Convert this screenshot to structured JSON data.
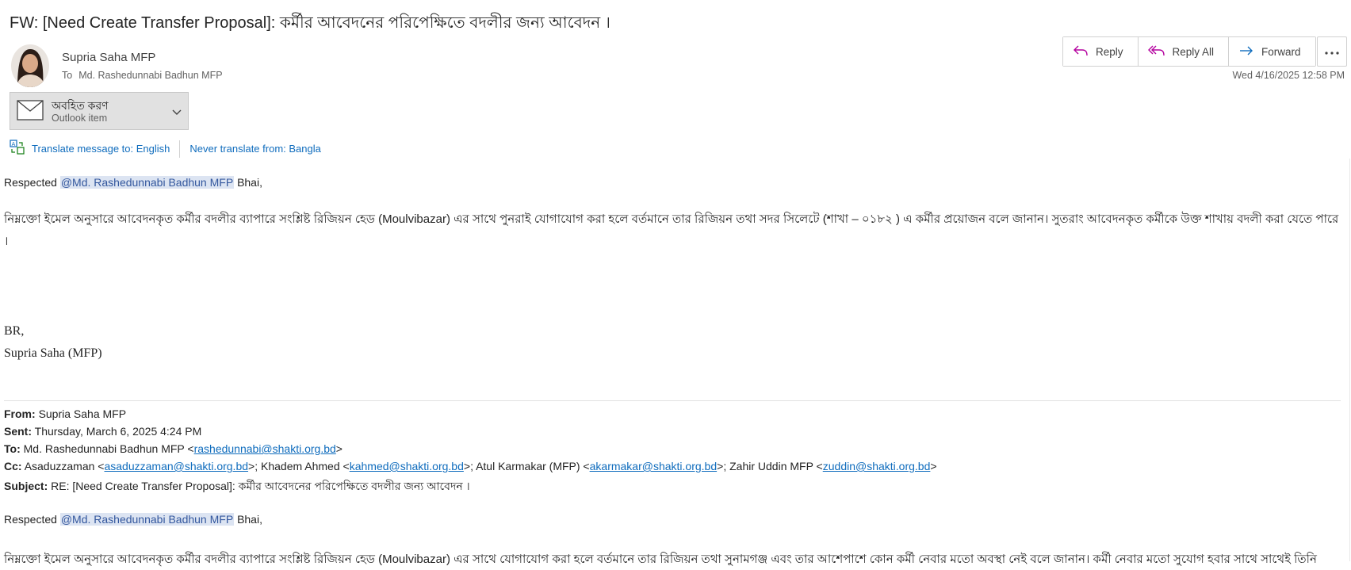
{
  "subject": "FW: [Need Create Transfer Proposal]: কর্মীর আবেদনের পরিপেক্ষিতে বদলীর জন্য আবেদন ।",
  "sender": {
    "name": "Supria Saha MFP",
    "to_label": "To",
    "to_name": "Md. Rashedunnabi Badhun MFP"
  },
  "actions": {
    "reply": "Reply",
    "reply_all": "Reply All",
    "forward": "Forward"
  },
  "date": "Wed 4/16/2025 12:58 PM",
  "attachment": {
    "name": "অবহিত করণ",
    "type": "Outlook item",
    "icon": "envelope-icon"
  },
  "translate": {
    "to": "Translate message to: English",
    "never": "Never translate from: Bangla"
  },
  "body": {
    "greeting_pre": "Respected",
    "mention": "@Md. Rashedunnabi Badhun MFP",
    "greeting_post": "Bhai,",
    "paragraph": "নিম্নক্তো ইমেল অনুসারে আবেদনকৃত কর্মীর বদলীর ব্যাপারে সংশ্লিষ্ট রিজিয়ন হেড (Moulvibazar) এর সাথে পুনরাই  যোগাযোগ করা হলে বর্তমানে তার রিজিয়ন তথা সদর সিলেটে (শাখা – ০১৮২ ) এ কর্মীর  প্রয়োজন বলে জানান। সুতরাং আবেদনকৃত কর্মীকে উক্ত শাখায় বদলী করা যেতে পারে ।",
    "closing": "BR,",
    "signature": "Supria Saha (MFP)"
  },
  "quoted": {
    "from_label": "From:",
    "from": "Supria Saha MFP",
    "sent_label": "Sent:",
    "sent": "Thursday, March 6, 2025 4:24 PM",
    "to_label": "To:",
    "to_name": "Md. Rashedunnabi Badhun MFP",
    "to_email": "rashedunnabi@shakti.org.bd",
    "cc_label": "Cc:",
    "cc": [
      {
        "name": "Asaduzzaman",
        "email": "asaduzzaman@shakti.org.bd"
      },
      {
        "name": "Khadem Ahmed",
        "email": "kahmed@shakti.org.bd"
      },
      {
        "name": "Atul Karmakar (MFP)",
        "email": "akarmakar@shakti.org.bd"
      },
      {
        "name": "Zahir Uddin MFP",
        "email": "zuddin@shakti.org.bd"
      }
    ],
    "subject_label": "Subject:",
    "subject": "RE: [Need Create Transfer Proposal]: কর্মীর আবেদনের পরিপেক্ষিতে বদলীর জন্য আবেদন ।",
    "greeting_pre": "Respected",
    "mention": "@Md. Rashedunnabi Badhun MFP",
    "greeting_post": "Bhai,",
    "paragraph_partial": "নিম্নক্তো ইমেল অনুসারে আবেদনকৃত কর্মীর বদলীর ব্যাপারে সংশ্লিষ্ট রিজিয়ন হেড (Moulvibazar) এর সাথে যোগাযোগ করা হলে বর্তমানে তার রিজিয়ন তথা সুনামগঞ্জ এবং তার আশেপাশে কোন কর্মী নেবার মতো অবস্থা নেই বলে জানান। কর্মী নেবার মতো সুযোগ  হবার সাথে সাথেই তিনি"
  },
  "colors": {
    "link": "#0f6cbd",
    "mention_bg": "#dce4f2",
    "mention_text": "#33579e",
    "attachment_bg": "#e1e1e1"
  }
}
